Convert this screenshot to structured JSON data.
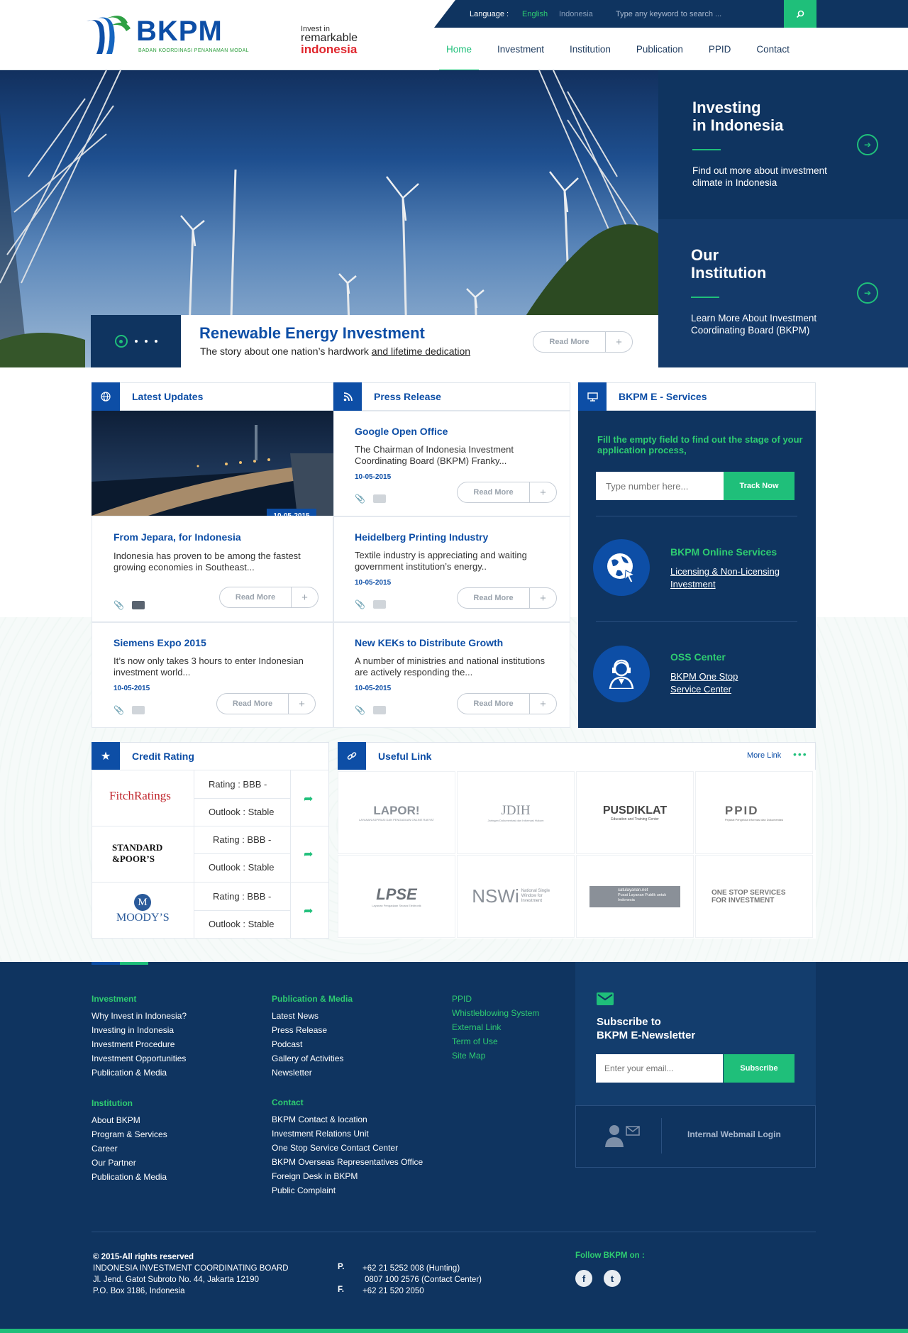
{
  "header": {
    "logo_text": "BKPM",
    "logo_subtitle": "BADAN KOORDINASI PENANAMAN MODAL",
    "tagline_1": "Invest in",
    "tagline_2": "remarkable",
    "tagline_3": "indonesia",
    "language_label": "Language :",
    "language_en": "English",
    "language_id": "Indonesia",
    "search_placeholder": "Type any keyword to search ...",
    "nav": [
      {
        "label": "Home",
        "active": true
      },
      {
        "label": "Investment",
        "active": false
      },
      {
        "label": "Institution",
        "active": false
      },
      {
        "label": "Publication",
        "active": false
      },
      {
        "label": "PPID",
        "active": false
      },
      {
        "label": "Contact",
        "active": false
      }
    ]
  },
  "hero": {
    "caption_title": "Renewable Energy Investment",
    "caption_text_1": "The story about one nation’s hardwork ",
    "caption_text_2": "and lifetime dedication",
    "read_more": "Read More",
    "plus": "+",
    "side": [
      {
        "title_1": "Investing",
        "title_2": "in Indonesia",
        "text": "Find out more about investment climate in Indonesia"
      },
      {
        "title_1": "Our",
        "title_2": "Institution",
        "text": "Learn More About Investment Coordinating Board (BKPM)"
      }
    ]
  },
  "latest_updates": {
    "title": "Latest Updates",
    "image_date": "10-05-2015",
    "items": [
      {
        "title": "From Jepara, for Indonesia",
        "text": "Indonesia has proven to be among the fastest growing economies in Southeast...",
        "read_more": "Read More"
      },
      {
        "title": "Siemens Expo 2015",
        "text": "It’s now only takes 3 hours to enter Indonesian investment world...",
        "date": "10-05-2015",
        "read_more": "Read More"
      }
    ]
  },
  "press_release": {
    "title": "Press Release",
    "items": [
      {
        "title": "Google Open Office",
        "text": "The Chairman of Indonesia Investment Coordinating Board (BKPM) Franky...",
        "date": "10-05-2015",
        "read_more": "Read More"
      },
      {
        "title": "Heidelberg Printing Industry",
        "text": "Textile industry is appreciating and waiting government institution’s energy..",
        "date": "10-05-2015",
        "read_more": "Read More"
      },
      {
        "title": "New KEKs to Distribute Growth",
        "text": "A number of ministries and national institutions are actively responding the...",
        "date": "10-05-2015",
        "read_more": "Read More"
      }
    ]
  },
  "eservices": {
    "title": "BKPM E - Services",
    "prompt": "Fill the empty field to find out the stage of your application process,",
    "input_placeholder": "Type number here...",
    "track_button": "Track Now",
    "services": [
      {
        "title": "BKPM Online Services",
        "link_1": "Licensing & Non-Licensing",
        "link_2": "Investment"
      },
      {
        "title": "OSS Center",
        "link_1": "BKPM One Stop",
        "link_2": "Service Center"
      }
    ]
  },
  "credit_rating": {
    "title": "Credit Rating",
    "rows": [
      {
        "agency": "FitchRatings",
        "rating": "Rating : BBB -",
        "outlook": "Outlook : Stable"
      },
      {
        "agency_1": "STANDARD",
        "agency_2": "&POOR’S",
        "rating": "Rating : BBB -",
        "outlook": "Outlook : Stable"
      },
      {
        "agency": "MOODY’S",
        "rating": "Rating : BBB -",
        "outlook": "Outlook : Stable"
      }
    ]
  },
  "useful_link": {
    "title": "Useful Link",
    "more": "More Link",
    "logos": [
      {
        "name": "LAPOR!",
        "sub": "LAYANAN ASPIRASI DAN PENGADUAN ONLINE RAKYAT"
      },
      {
        "name": "JDIH",
        "sub": "Jaringan Dokumentasi dan Informasi Hukum"
      },
      {
        "name": "PUSDIKLAT",
        "sub": "Education and Training Center"
      },
      {
        "name": "PPID",
        "sub": "Pejabat Pengelola Informasi dan Dokumentasi"
      },
      {
        "name": "LPSE",
        "sub": "Layanan Pengadaan Secara Elektronik"
      },
      {
        "name": "NSWi",
        "sub": "National Single Window for Investment"
      },
      {
        "name": "satulayanan.net",
        "sub": "Pusat Layanan Publik untuk Indonesia"
      },
      {
        "name": "ONE STOP SERVICES FOR INVESTMENT",
        "sub": ""
      }
    ]
  },
  "footer": {
    "col1_head": "Investment",
    "col1_links": [
      "Why Invest in Indonesia?",
      "Investing in Indonesia",
      "Investment Procedure",
      "Investment Opportunities",
      "Publication & Media"
    ],
    "col1b_head": "Institution",
    "col1b_links": [
      "About BKPM",
      "Program & Services",
      "Career",
      "Our Partner",
      "Publication & Media"
    ],
    "col2_head": "Publication & Media",
    "col2_links": [
      "Latest News",
      "Press Release",
      "Podcast",
      "Gallery of Activities",
      "Newsletter"
    ],
    "col2b_head": "Contact",
    "col2b_links": [
      "BKPM Contact & location",
      "Investment Relations Unit",
      "One Stop Service Contact Center",
      "BKPM Overseas Representatives Office",
      "Foreign Desk in BKPM",
      "Public Complaint"
    ],
    "col3_links": [
      "PPID",
      "Whistleblowing System",
      "External Link",
      "Term of Use",
      "Site Map"
    ],
    "newsletter_title_1": "Subscribe to",
    "newsletter_title_2": "BKPM E-Newsletter",
    "email_placeholder": "Enter your email...",
    "subscribe": "Subscribe",
    "webmail": "Internal Webmail Login",
    "copyright": "© 2015-All rights reserved",
    "org": "INDONESIA INVESTMENT COORDINATING BOARD",
    "address_1": "Jl. Jend. Gatot Subroto No. 44, Jakarta 12190",
    "address_2": "P.O. Box 3186, Indonesia",
    "phone_label": "P.",
    "phone_1": "+62 21 5252 008 (Hunting)",
    "phone_2": "0807 100 2576 (Contact Center)",
    "fax_label": "F.",
    "fax": "+62 21 520 2050",
    "follow": "Follow BKPM  on :",
    "social_facebook": "f",
    "social_twitter": "t"
  },
  "colors": {
    "primary": "#0d4ea6",
    "navy": "#0f3460",
    "accent": "#1fbf7a"
  }
}
